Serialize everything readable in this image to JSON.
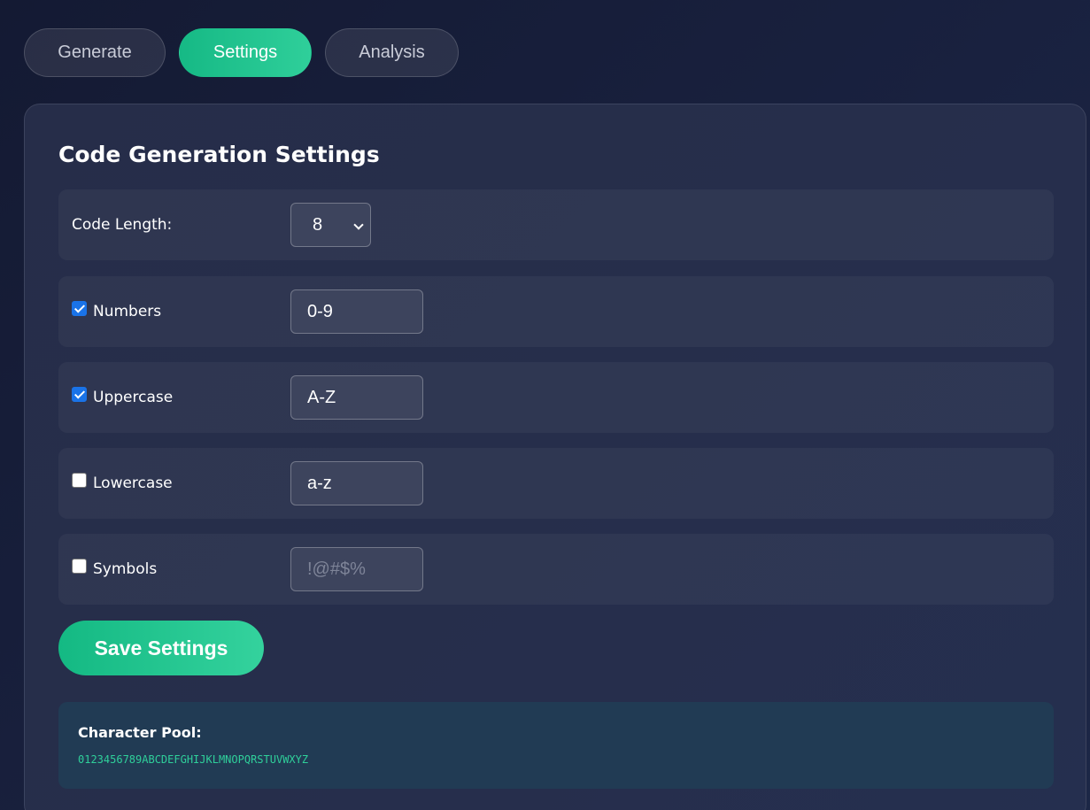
{
  "tabs": [
    {
      "label": "Generate",
      "active": false
    },
    {
      "label": "Settings",
      "active": true
    },
    {
      "label": "Analysis",
      "active": false
    }
  ],
  "settings": {
    "title": "Code Generation Settings",
    "length": {
      "label": "Code Length:",
      "value": "8"
    },
    "numbers": {
      "label": "Numbers",
      "checked": true,
      "value": "0-9",
      "placeholder": ""
    },
    "uppercase": {
      "label": "Uppercase",
      "checked": true,
      "value": "A-Z",
      "placeholder": ""
    },
    "lowercase": {
      "label": "Lowercase",
      "checked": false,
      "value": "a-z",
      "placeholder": ""
    },
    "symbols": {
      "label": "Symbols",
      "checked": false,
      "value": "",
      "placeholder": "!@#$%"
    },
    "save_label": "Save Settings"
  },
  "pool": {
    "title": "Character Pool:",
    "chars": "0123456789ABCDEFGHIJKLMNOPQRSTUVWXYZ"
  },
  "colors": {
    "accent": "#1dc48d",
    "background": "#171d38",
    "checkbox": "#1a73e8"
  }
}
